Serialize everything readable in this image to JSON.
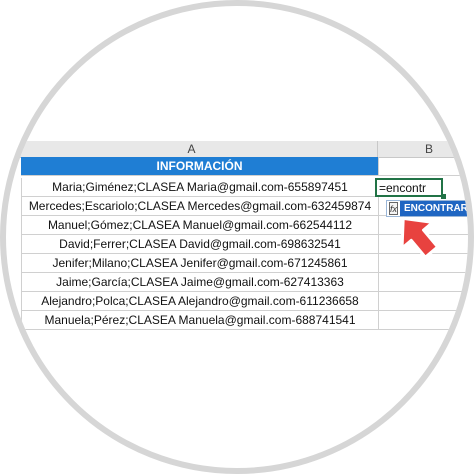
{
  "columns": {
    "a": "A",
    "b": "B"
  },
  "header_cell": "INFORMACIÓN",
  "rows": [
    "Maria;Giménez;CLASEA Maria@gmail.com-655897451",
    "Mercedes;Escariolo;CLASEA Mercedes@gmail.com-632459874",
    "Manuel;Gómez;CLASEA Manuel@gmail.com-662544112",
    "David;Ferrer;CLASEA David@gmail.com-698632541",
    "Jenifer;Milano;CLASEA Jenifer@gmail.com-671245861",
    "Jaime;García;CLASEA Jaime@gmail.com-627413363",
    "Alejandro;Polca;CLASEA Alejandro@gmail.com-611236658",
    "Manuela;Pérez;CLASEA Manuela@gmail.com-688741541"
  ],
  "editing_cell": {
    "value": "=encontr"
  },
  "autocomplete": {
    "icon": "fx-icon",
    "label": "ENCONTRAR"
  },
  "colors": {
    "header_blue": "#1f7ed4",
    "arrow_red": "#e8423f",
    "selection_green": "#217346"
  }
}
